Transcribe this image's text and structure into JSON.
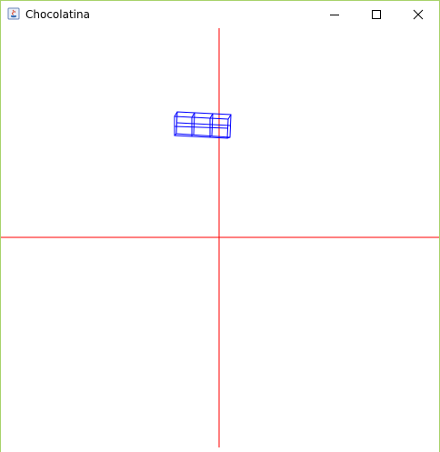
{
  "window": {
    "title": "Chocolatina",
    "icons": {
      "app": "java-icon",
      "minimize": "minimize-icon",
      "maximize": "maximize-icon",
      "close": "close-icon"
    }
  },
  "scene": {
    "axis_color": "#ff0000",
    "wireframe_color": "#0000ff",
    "object": "wireframe-chocolate-bar",
    "segments": 3
  }
}
